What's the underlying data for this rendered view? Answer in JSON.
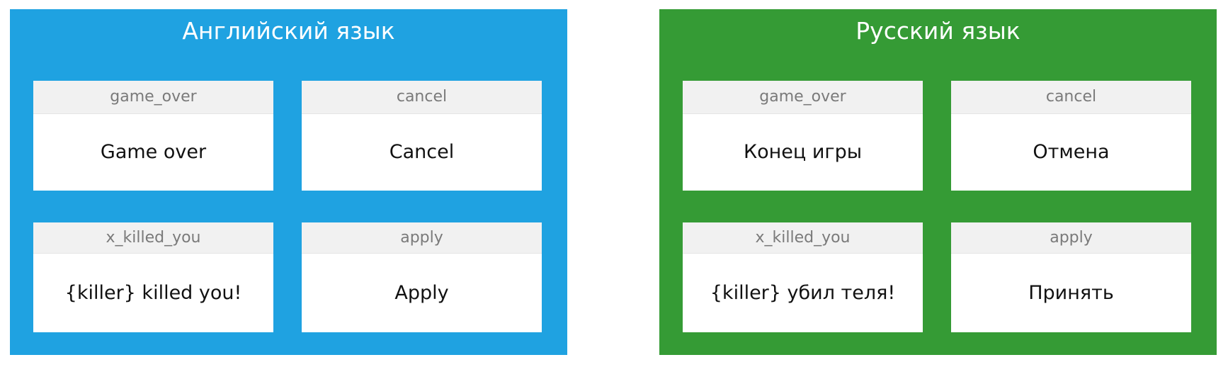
{
  "panels": [
    {
      "title": "Английский язык",
      "color": "#1fa2e1",
      "entries": [
        {
          "key": "game_over",
          "value": "Game over"
        },
        {
          "key": "cancel",
          "value": "Cancel"
        },
        {
          "key": "x_killed_you",
          "value": "{killer} killed you!"
        },
        {
          "key": "apply",
          "value": "Apply"
        }
      ]
    },
    {
      "title": "Русский язык",
      "color": "#359b35",
      "entries": [
        {
          "key": "game_over",
          "value": "Конец игры"
        },
        {
          "key": "cancel",
          "value": "Отмена"
        },
        {
          "key": "x_killed_you",
          "value": "{killer} убил теля!"
        },
        {
          "key": "apply",
          "value": "Принять"
        }
      ]
    }
  ]
}
